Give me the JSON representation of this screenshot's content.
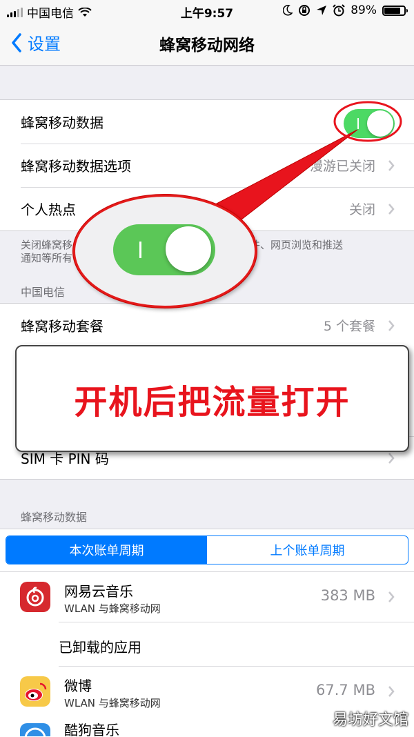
{
  "status_bar": {
    "carrier": "中国电信",
    "time": "上午9:57",
    "battery_percent": "89%",
    "battery_level": 0.89,
    "icons": [
      "signal-icon",
      "wifi-icon",
      "moon-icon",
      "lock-rotation-icon",
      "location-icon",
      "alarm-icon",
      "battery-icon"
    ]
  },
  "nav": {
    "back_label": "设置",
    "title": "蜂窝移动网络"
  },
  "cellular_group": {
    "cellular_data_label": "蜂窝移动数据",
    "cellular_data_on": true,
    "options_label": "蜂窝移动数据选项",
    "options_value": "漫游已关闭",
    "hotspot_label": "个人热点",
    "hotspot_value": "关闭"
  },
  "footnote": {
    "line1_start": "关闭蜂窝移",
    "line1_end": "子邮件、网页浏览和推送",
    "line2_start": "通知等所有"
  },
  "carrier_section": {
    "header": "中国电信",
    "plan_label": "蜂窝移动套餐",
    "plan_value": "5 个套餐",
    "sim_pin_label": "SIM 卡 PIN 码"
  },
  "usage_section": {
    "header": "蜂窝移动数据",
    "tabs": [
      "本次账单周期",
      "上个账单周期"
    ],
    "active_tab": 0,
    "apps": [
      {
        "name": "网易云音乐",
        "sub": "WLAN 与蜂窝移动网",
        "size": "383 MB",
        "icon": "netease-music-icon",
        "color": "#d6292e"
      },
      {
        "name": "微博",
        "sub": "WLAN 与蜂窝移动网",
        "size": "67.7 MB",
        "icon": "weibo-icon",
        "color": "#f7c948"
      },
      {
        "name": "酷狗音乐",
        "icon": "kugou-music-icon",
        "color": "#2f8fe6"
      }
    ],
    "uninstalled_label": "已卸载的应用"
  },
  "annotation": {
    "callout_text": "开机后把流量打开",
    "highlight_color": "#e8141d"
  },
  "watermark": "易坊好文馆"
}
